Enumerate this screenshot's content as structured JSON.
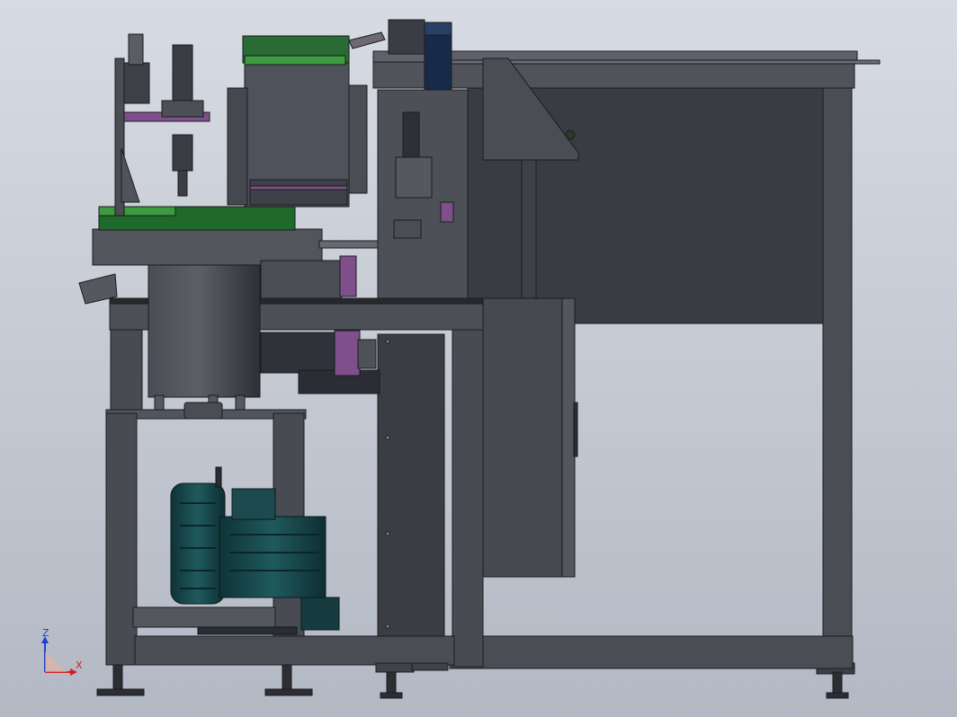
{
  "viewport": {
    "background_top": "#d7dbe3",
    "background_bottom": "#b3b9c4"
  },
  "colors": {
    "frame": "#3f4249",
    "frame_light": "#5a5e66",
    "frame_edge": "#1a1c20",
    "panel": "#3a3d44",
    "green": "#1f6a2a",
    "green_light": "#3c9a3f",
    "purple": "#7e4f8a",
    "blower": "#1c4a4e",
    "motor_blue": "#182a4a"
  },
  "triad": {
    "z_label": "Z",
    "x_label": "X",
    "z_color": "#1f3fd0",
    "x_color": "#d02020"
  },
  "components": [
    "machine-frame",
    "vibratory-bowl-feeder",
    "servo-motor",
    "vacuum-blower",
    "electrical-cabinet",
    "conveyor-rail"
  ]
}
